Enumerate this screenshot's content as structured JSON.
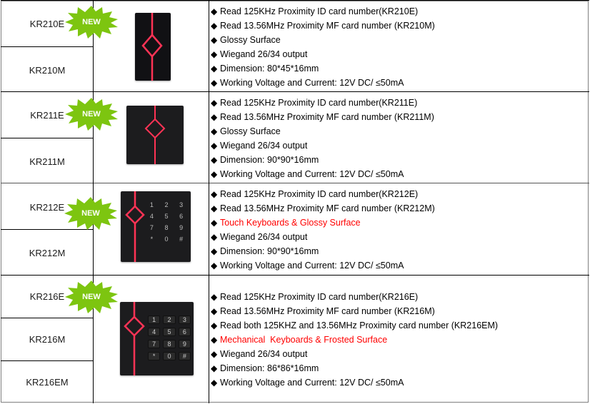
{
  "colors": {
    "badge_green": "#7dc510",
    "highlight_red": "#ff0000",
    "led_red": "#ff3355",
    "device_body": "#1c1c1e"
  },
  "badge_label": "NEW",
  "products": [
    {
      "models": [
        "KR210E",
        "KR210M"
      ],
      "badge": "NEW",
      "image": "slim-reader-led-diamond",
      "specs": [
        {
          "text": "Read 125KHz Proximity ID card number(KR210E)",
          "highlight": false
        },
        {
          "text": "Read 13.56MHz Proximity MF card number (KR210M)",
          "highlight": false
        },
        {
          "text": "Glossy Surface",
          "highlight": false
        },
        {
          "text": "Wiegand 26/34 output",
          "highlight": false
        },
        {
          "text": "Dimension: 80*45*16mm",
          "highlight": false
        },
        {
          "text": "Working Voltage and Current: 12V DC/ ≤50mA",
          "highlight": false
        }
      ]
    },
    {
      "models": [
        "KR211E",
        "KR211M"
      ],
      "badge": "NEW",
      "image": "square-reader-led-diamond",
      "specs": [
        {
          "text": "Read 125KHz Proximity ID card number(KR211E)",
          "highlight": false
        },
        {
          "text": "Read 13.56MHz Proximity MF card number (KR211M)",
          "highlight": false
        },
        {
          "text": "Glossy Surface",
          "highlight": false
        },
        {
          "text": "Wiegand 26/34 output",
          "highlight": false
        },
        {
          "text": "Dimension: 90*90*16mm",
          "highlight": false
        },
        {
          "text": "Working Voltage and Current: 12V DC/ ≤50mA",
          "highlight": false
        }
      ]
    },
    {
      "models": [
        "KR212E",
        "KR212M"
      ],
      "badge": "NEW",
      "image": "touch-keypad-reader",
      "keys": [
        "1",
        "2",
        "3",
        "4",
        "5",
        "6",
        "7",
        "8",
        "9",
        "*",
        "0",
        "#"
      ],
      "specs": [
        {
          "text": "Read 125KHz Proximity ID card number(KR212E)",
          "highlight": false
        },
        {
          "text": "Read 13.56MHz Proximity MF card number (KR212M)",
          "highlight": false
        },
        {
          "text": "Touch Keyboards & Glossy Surface",
          "highlight": true
        },
        {
          "text": "Wiegand 26/34 output",
          "highlight": false
        },
        {
          "text": "Dimension: 90*90*16mm",
          "highlight": false
        },
        {
          "text": "Working Voltage and Current: 12V DC/ ≤50mA",
          "highlight": false
        }
      ]
    },
    {
      "models": [
        "KR216E",
        "KR216M",
        "KR216EM"
      ],
      "badge": "NEW",
      "image": "mechanical-keypad-reader",
      "keys": [
        "1",
        "2",
        "3",
        "4",
        "5",
        "6",
        "7",
        "8",
        "9",
        "*",
        "0",
        "#"
      ],
      "specs": [
        {
          "text": "Read 125KHz Proximity ID card number(KR216E)",
          "highlight": false
        },
        {
          "text": "Read 13.56MHz Proximity MF card number (KR216M)",
          "highlight": false
        },
        {
          "text": "Read both 125KHZ and 13.56MHz Proximity card number (KR216EM)",
          "highlight": false
        },
        {
          "text": "Mechanical  Keyboards & Frosted Surface",
          "highlight": true
        },
        {
          "text": "Wiegand 26/34 output",
          "highlight": false
        },
        {
          "text": "Dimension: 86*86*16mm",
          "highlight": false
        },
        {
          "text": "Working Voltage and Current: 12V DC/ ≤50mA",
          "highlight": false
        }
      ]
    }
  ]
}
